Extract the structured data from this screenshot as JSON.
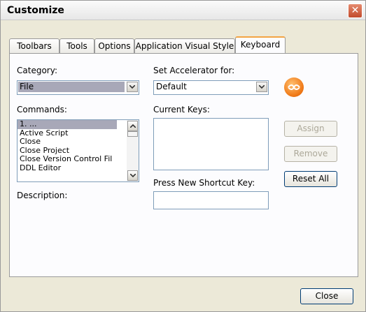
{
  "window": {
    "title": "Customize"
  },
  "tabs": [
    "Toolbars",
    "Tools",
    "Options",
    "Application Visual Style",
    "Keyboard"
  ],
  "active_tab": "Keyboard",
  "category": {
    "label": "Category:",
    "value": "File"
  },
  "accelerator": {
    "label": "Set Accelerator for:",
    "value": "Default"
  },
  "commands": {
    "label": "Commands:",
    "items": [
      "1. ...",
      "Active Script",
      "Close",
      "Close Project",
      "Close Version Control Fil",
      "DDL Editor"
    ]
  },
  "current_keys": {
    "label": "Current Keys:"
  },
  "shortcut": {
    "label": "Press New Shortcut Key:",
    "value": ""
  },
  "description": {
    "label": "Description:"
  },
  "buttons": {
    "assign": "Assign",
    "remove": "Remove",
    "reset_all": "Reset All",
    "close": "Close"
  },
  "colors": {
    "active_tab_accent": "#f3a443",
    "selection": "#a8a8b8",
    "accelerator_icon": "#f07a18"
  }
}
